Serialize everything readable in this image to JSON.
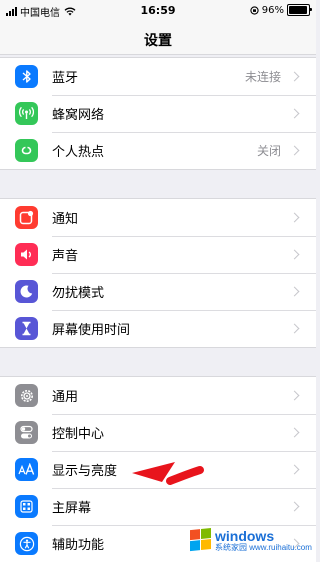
{
  "status_bar": {
    "carrier": "中国电信",
    "time": "16:59",
    "battery_percent": "96%",
    "battery_level": 0.96
  },
  "nav": {
    "title": "设置"
  },
  "groups": [
    {
      "items": [
        {
          "label": "蓝牙",
          "value": "未连接",
          "icon": "bluetooth-icon",
          "color": "#0a7aff"
        },
        {
          "label": "蜂窝网络",
          "value": "",
          "icon": "cellular-antenna-icon",
          "color": "#34c759"
        },
        {
          "label": "个人热点",
          "value": "关闭",
          "icon": "personal-hotspot-icon",
          "color": "#34c759"
        }
      ]
    },
    {
      "items": [
        {
          "label": "通知",
          "value": "",
          "icon": "notifications-icon",
          "color": "#ff3b30"
        },
        {
          "label": "声音",
          "value": "",
          "icon": "speaker-icon",
          "color": "#ff2d55"
        },
        {
          "label": "勿扰模式",
          "value": "",
          "icon": "moon-icon",
          "color": "#5856d6"
        },
        {
          "label": "屏幕使用时间",
          "value": "",
          "icon": "hourglass-icon",
          "color": "#5856d6"
        }
      ]
    },
    {
      "items": [
        {
          "label": "通用",
          "value": "",
          "icon": "gear-icon",
          "color": "#8e8e93"
        },
        {
          "label": "控制中心",
          "value": "",
          "icon": "toggle-switches-icon",
          "color": "#8e8e93"
        },
        {
          "label": "显示与亮度",
          "value": "",
          "icon": "text-size-icon",
          "color": "#0a7aff"
        },
        {
          "label": "主屏幕",
          "value": "",
          "icon": "home-screen-grid-icon",
          "color": "#0a7aff"
        },
        {
          "label": "辅助功能",
          "value": "",
          "icon": "accessibility-icon",
          "color": "#0a7aff"
        }
      ]
    }
  ],
  "annotation": {
    "arrow_color": "#e8141c"
  },
  "watermark": {
    "main": "windows",
    "sub": "系统家园",
    "url": "www.ruihaitu.com"
  }
}
